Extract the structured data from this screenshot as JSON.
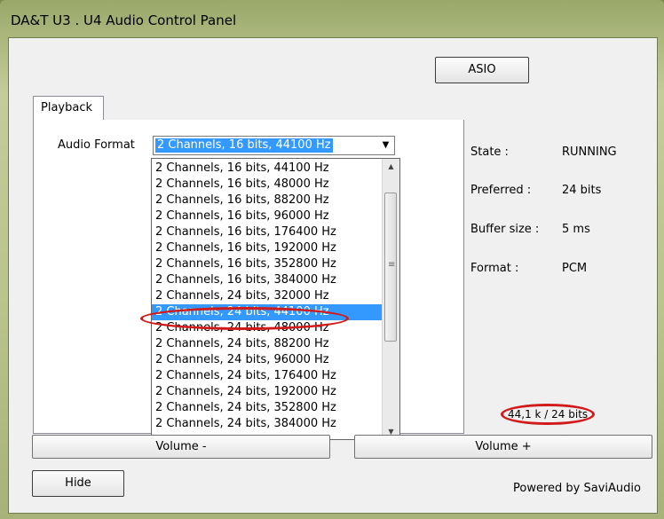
{
  "window": {
    "title": "DA&T  U3 . U4  Audio Control Panel"
  },
  "toolbar": {
    "asio_label": "ASIO"
  },
  "tabs": [
    {
      "label": "Playback"
    }
  ],
  "playback": {
    "audio_format_label": "Audio Format",
    "selected_format": "2 Channels, 16 bits, 44100 Hz",
    "options": [
      "2 Channels, 16 bits, 44100 Hz",
      "2 Channels, 16 bits, 48000 Hz",
      "2 Channels, 16 bits, 88200 Hz",
      "2 Channels, 16 bits, 96000 Hz",
      "2 Channels, 16 bits, 176400 Hz",
      "2 Channels, 16 bits, 192000 Hz",
      "2 Channels, 16 bits, 352800 Hz",
      "2 Channels, 16 bits, 384000 Hz",
      "2 Channels, 24 bits, 32000 Hz",
      "2 Channels, 24 bits, 44100 Hz",
      "2 Channels, 24 bits, 48000 Hz",
      "2 Channels, 24 bits, 88200 Hz",
      "2 Channels, 24 bits, 96000 Hz",
      "2 Channels, 24 bits, 176400 Hz",
      "2 Channels, 24 bits, 192000 Hz",
      "2 Channels, 24 bits, 352800 Hz",
      "2 Channels, 24 bits, 384000 Hz"
    ],
    "highlighted_index": 9
  },
  "status": {
    "state_label": "State :",
    "state_value": "RUNNING",
    "preferred_label": "Preferred :",
    "preferred_value": "24 bits",
    "buffer_label": "Buffer size :",
    "buffer_value": "5 ms",
    "format_label": "Format :",
    "format_value": "PCM",
    "rate_readout": "44,1 k / 24 bits"
  },
  "controls": {
    "volume_down_label": "Volume -",
    "volume_up_label": "Volume +",
    "hide_label": "Hide",
    "powered_by": "Powered by SaviAudio"
  },
  "colors": {
    "selection": "#3399ff",
    "annotation": "#d11a1a"
  }
}
